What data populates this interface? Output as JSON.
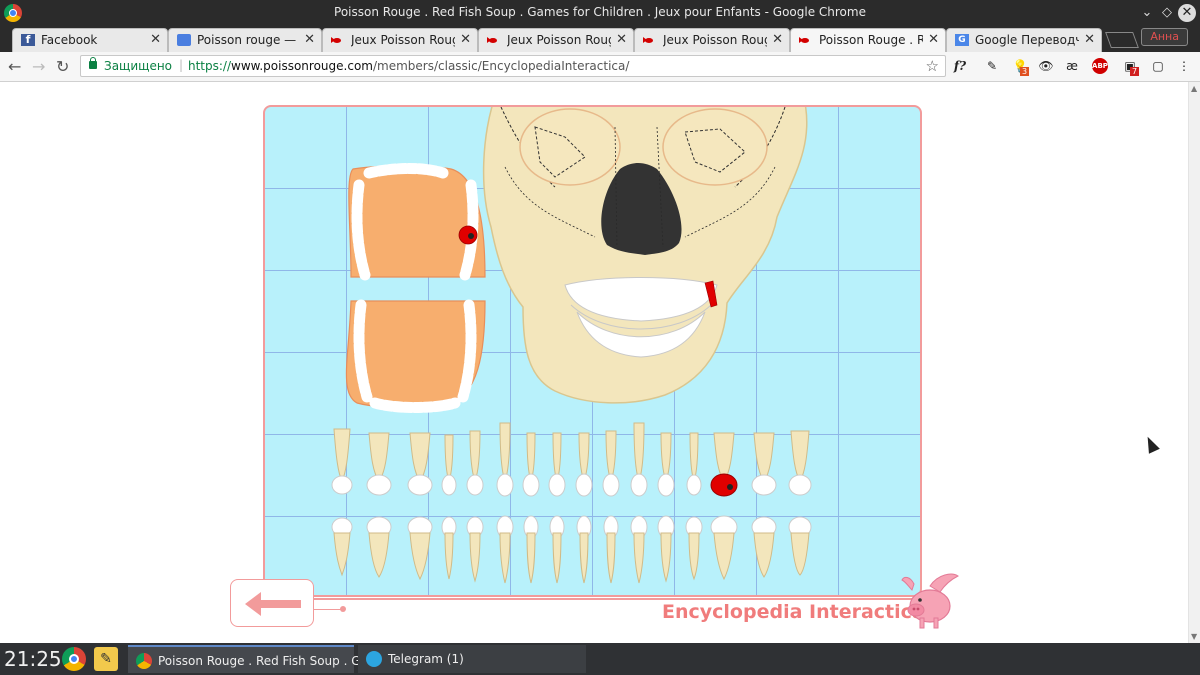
{
  "window": {
    "title": "Poisson Rouge . Red Fish Soup . Games for Children . Jeux pour Enfants - Google Chrome"
  },
  "tabs": [
    {
      "label": "Facebook",
      "icon": "facebook-icon"
    },
    {
      "label": "Poisson rouge — и",
      "icon": "docs-icon"
    },
    {
      "label": "Jeux Poisson Rouge",
      "icon": "red-fish-icon"
    },
    {
      "label": "Jeux Poisson Rouge",
      "icon": "red-fish-icon"
    },
    {
      "label": "Jeux Poisson Rouge",
      "icon": "red-fish-icon"
    },
    {
      "label": "Poisson Rouge . Rec",
      "icon": "red-fish-icon",
      "active": true
    },
    {
      "label": "Google Переводчи",
      "icon": "google-translate-icon"
    }
  ],
  "user_badge": "Анна",
  "toolbar": {
    "secure_label": "Защищено",
    "url_scheme": "https://",
    "url_host": "www.poissonrouge.com",
    "url_path": "/members/classic/EncyclopediaInteractica/",
    "ext_badges": {
      "ext3": "3",
      "ext7": "7"
    },
    "ext_labels": {
      "fx": "f?",
      "ae": "æ",
      "abp": "ABP"
    }
  },
  "app": {
    "title": "Encyclopedia Interactica"
  },
  "taskbar": {
    "clock": "21:25",
    "items": [
      {
        "label": "Poisson Rouge . Red Fish Soup . G...",
        "active": true
      },
      {
        "label": "Telegram (1)",
        "active": false
      }
    ]
  },
  "colors": {
    "board_bg": "#b8f1fb",
    "accent_pink": "#f29b9b",
    "decay_red": "#e00000",
    "gum_orange": "#f7ae6e",
    "bone": "#f3e6bc"
  }
}
